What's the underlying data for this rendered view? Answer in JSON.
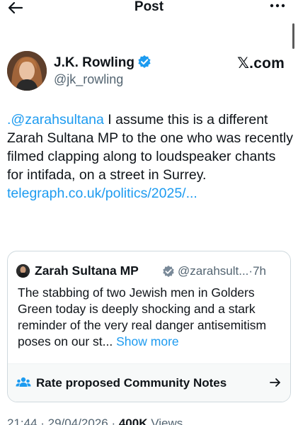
{
  "header": {
    "title": "Post"
  },
  "author": {
    "name": "J.K. Rowling",
    "handle": "@jk_rowling",
    "source_logo": "𝕏.com"
  },
  "post": {
    "mention": ".@zarahsultana",
    "text": " I assume this is a different Zarah Sultana MP to the one who was recently filmed clapping along to loudspeaker chants for intifada, on a street in Surrey.",
    "link": "telegraph.co.uk/politics/2025/..."
  },
  "quote": {
    "name": "Zarah Sultana MP",
    "meta": "@zarahsult...·7h",
    "text": "The stabbing of two Jewish men in Golders Green today is deeply shocking and a stark reminder of the very real danger antisemitism poses on our st...",
    "show_more": "Show more"
  },
  "community_notes": {
    "label": "Rate proposed Community Notes"
  },
  "footer": {
    "timestamp": "21:44 · 29/04/2026 · ",
    "views_count": "400K",
    "views_label": " Views"
  },
  "colors": {
    "accent": "#1d9bf0",
    "verified": "#1d9bf0",
    "secondary_text": "#536471",
    "border": "#cfd9de"
  },
  "icons": [
    "arrow-left-icon",
    "more-horizontal-icon",
    "verified-badge-icon",
    "people-icon",
    "arrow-right-icon"
  ]
}
